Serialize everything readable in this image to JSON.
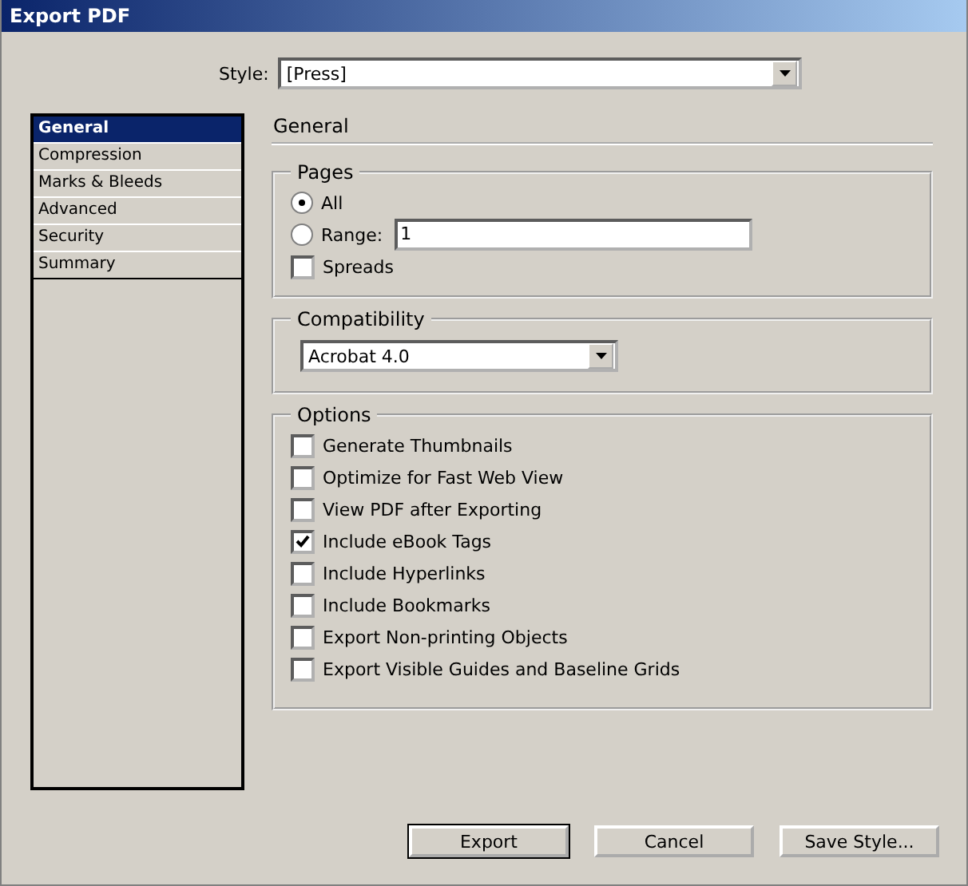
{
  "window": {
    "title": "Export PDF"
  },
  "style": {
    "label": "Style:",
    "value": "[Press]"
  },
  "sidebar": {
    "items": [
      {
        "label": "General",
        "selected": true
      },
      {
        "label": "Compression",
        "selected": false
      },
      {
        "label": "Marks & Bleeds",
        "selected": false
      },
      {
        "label": "Advanced",
        "selected": false
      },
      {
        "label": "Security",
        "selected": false
      },
      {
        "label": "Summary",
        "selected": false
      }
    ]
  },
  "panel": {
    "title": "General",
    "pages": {
      "legend": "Pages",
      "radios": [
        {
          "label": "All",
          "selected": true
        },
        {
          "label": "Range:",
          "selected": false
        }
      ],
      "range_value": "1",
      "spreads": {
        "label": "Spreads",
        "checked": false
      }
    },
    "compatibility": {
      "legend": "Compatibility",
      "value": "Acrobat 4.0"
    },
    "options": {
      "legend": "Options",
      "items": [
        {
          "label": "Generate Thumbnails",
          "checked": false
        },
        {
          "label": "Optimize for Fast Web View",
          "checked": false
        },
        {
          "label": "View PDF after Exporting",
          "checked": false
        },
        {
          "label": "Include eBook Tags",
          "checked": true
        },
        {
          "label": "Include Hyperlinks",
          "checked": false
        },
        {
          "label": "Include Bookmarks",
          "checked": false
        },
        {
          "label": "Export Non-printing Objects",
          "checked": false
        },
        {
          "label": "Export Visible Guides and Baseline Grids",
          "checked": false
        }
      ]
    }
  },
  "buttons": [
    {
      "label": "Export",
      "default": true
    },
    {
      "label": "Cancel",
      "default": false
    },
    {
      "label": "Save Style...",
      "default": false
    }
  ]
}
